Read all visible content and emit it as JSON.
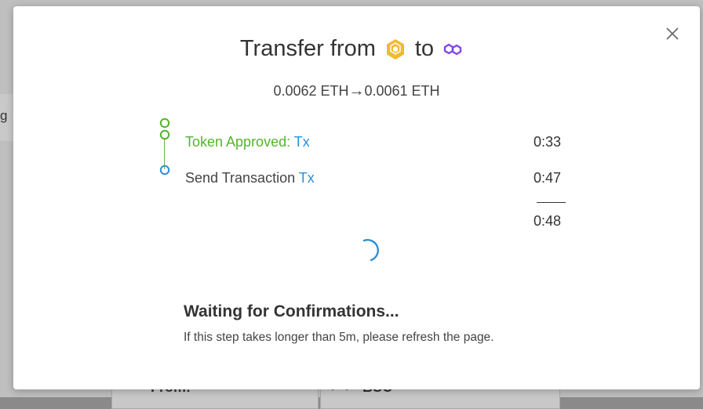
{
  "background": {
    "left_fragment": "g",
    "from_label": "From:",
    "chain_label": "BSC"
  },
  "modal": {
    "title_prefix": "Transfer from",
    "title_mid": "to",
    "from_chain_icon": "bnb-chain-icon",
    "to_chain_icon": "polygon-icon",
    "amount_from": "0.0062 ETH",
    "amount_arrow": "→",
    "amount_to": "0.0061 ETH",
    "steps": [
      {
        "label": "Token Approved:",
        "link": "Tx",
        "time": "0:33",
        "status": "complete",
        "color": "#52b52a"
      },
      {
        "label": "Send Transaction",
        "link": "Tx",
        "time": "0:47",
        "status": "active",
        "color": "#2e8fd4"
      }
    ],
    "total_time": "0:48",
    "waiting_title": "Waiting for Confirmations...",
    "waiting_subtitle": "If this step takes longer than 5m, please refresh the page."
  },
  "colors": {
    "success": "#52b52a",
    "link": "#2e8fd4",
    "bnb": "#F3BA2F",
    "polygon": "#8247E5"
  }
}
